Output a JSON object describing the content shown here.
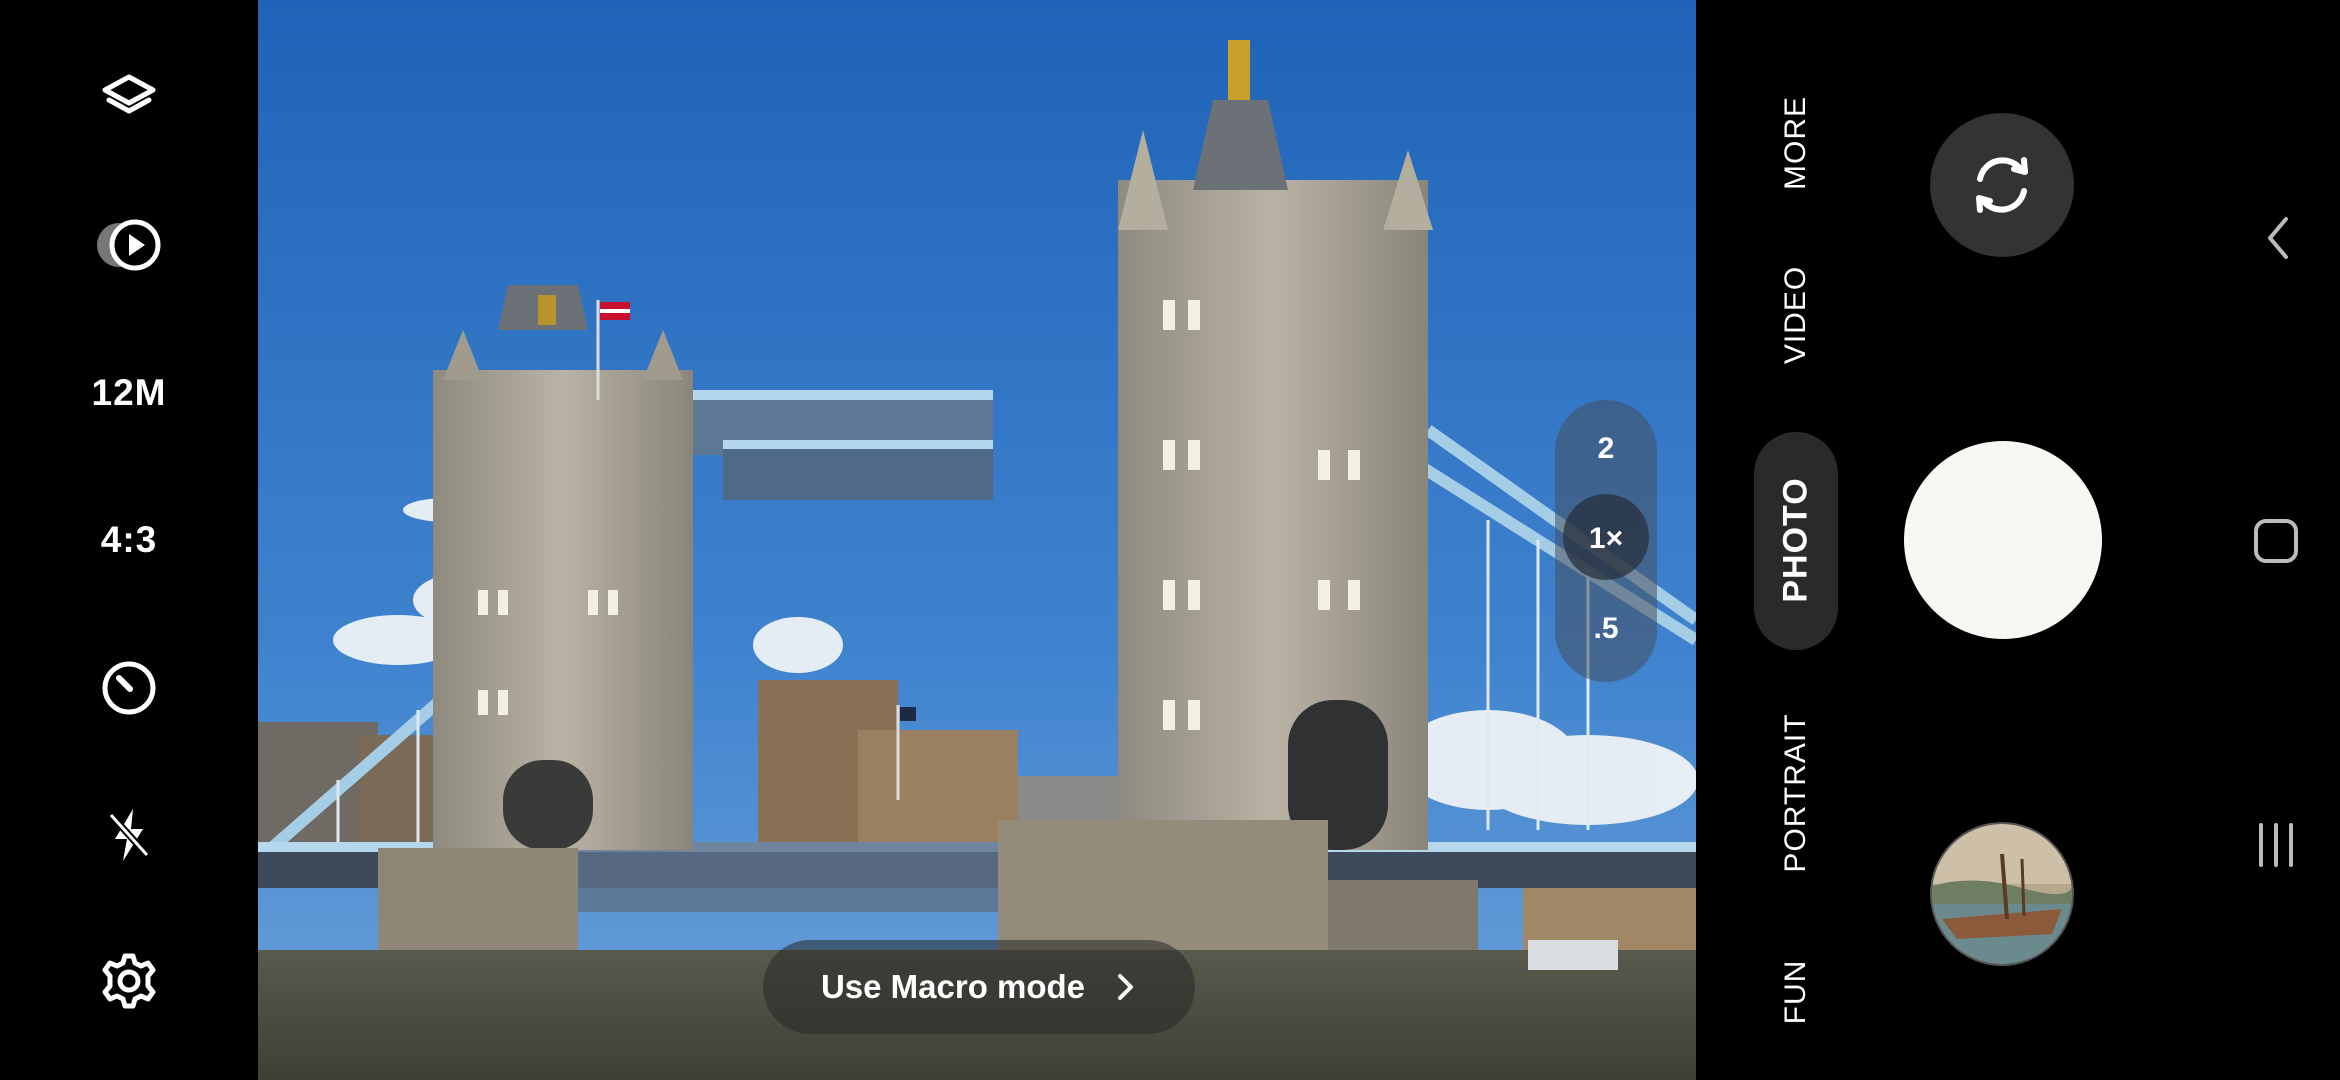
{
  "left_toolbar": {
    "items": [
      {
        "icon": "layers-icon"
      },
      {
        "icon": "motion-photo-icon"
      },
      {
        "label": "12M"
      },
      {
        "label": "4:3"
      },
      {
        "icon": "timer-icon"
      },
      {
        "icon": "flash-off-icon"
      },
      {
        "icon": "settings-icon"
      }
    ]
  },
  "zoom": {
    "options": [
      "2",
      "1×",
      ".5"
    ],
    "selected": "1×"
  },
  "macro_prompt": {
    "label": "Use Macro mode",
    "icon": "chevron-right-icon"
  },
  "modes": {
    "items": [
      "MORE",
      "VIDEO",
      "PHOTO",
      "PORTRAIT",
      "FUN"
    ],
    "selected": "PHOTO"
  },
  "controls": {
    "flip_icon": "switch-camera-icon",
    "shutter_icon": "shutter-button",
    "gallery_icon": "gallery-thumbnail"
  },
  "nav": {
    "back_icon": "back-icon",
    "home_icon": "home-icon",
    "recents_icon": "recents-icon"
  },
  "colors": {
    "background": "#000000",
    "shutter": "#f8f7f2",
    "pill": "#2a2a2a"
  }
}
